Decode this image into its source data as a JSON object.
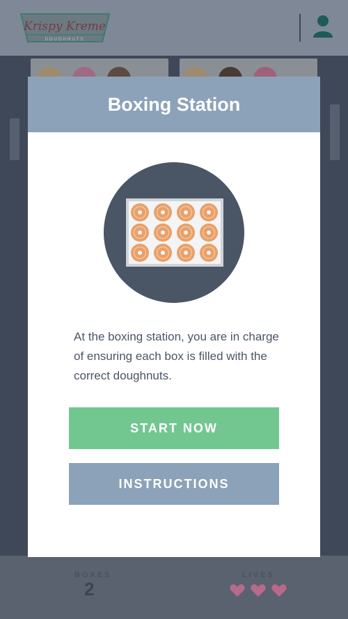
{
  "header": {
    "brand_line1": "Krispy Kreme",
    "brand_line2": "DOUGHNUTS"
  },
  "modal": {
    "title": "Boxing Station",
    "description": "At the boxing station, you are in charge of ensuring each box is filled with the correct doughnuts.",
    "start_label": "START NOW",
    "instructions_label": "INSTRUCTIONS"
  },
  "footer": {
    "boxes_label": "BOXES",
    "boxes_value": "2",
    "lives_label": "LIVES",
    "lives": 3
  },
  "colors": {
    "modal_header": "#8ca2b8",
    "start_button": "#72c791",
    "instructions_button": "#8ca2b8",
    "illustration_bg": "#4a5566",
    "heart": "#b86a8a"
  },
  "icons": [
    "krispy-kreme-logo",
    "user-icon",
    "doughnut-box-icon",
    "heart-icon"
  ]
}
